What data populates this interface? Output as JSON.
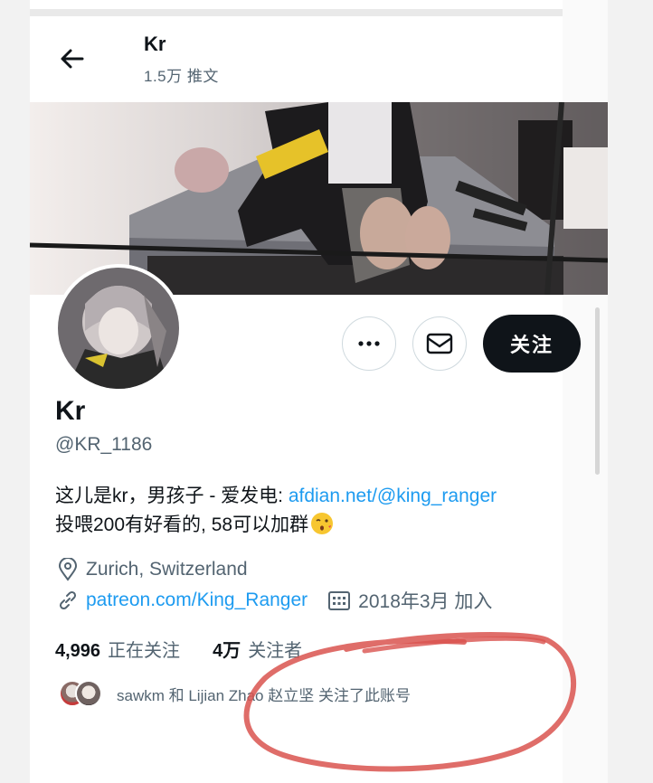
{
  "header": {
    "name": "Kr",
    "tweet_count": "1.5万 推文"
  },
  "actions": {
    "follow_label": "关注"
  },
  "profile": {
    "name": "Kr",
    "handle": "@KR_1186",
    "bio_text": "这儿是kr，男孩子 - 爱发电: ",
    "bio_link": "afdian.net/@king_ranger",
    "bio_line2": " 投喂200有好看的, 58可以加群",
    "location": "Zurich, Switzerland",
    "website": "patreon.com/King_Ranger",
    "joined": "2018年3月 加入"
  },
  "stats": {
    "following_count": "4,996",
    "following_label": "正在关注",
    "followers_count": "4万",
    "followers_label": "关注者"
  },
  "followed_by": {
    "text": "sawkm 和 Lijian Zhao 赵立坚 关注了此账号"
  },
  "colors": {
    "link": "#1d9bf0",
    "text": "#0f1419",
    "secondary": "#536471",
    "annotation": "#d9534f"
  }
}
